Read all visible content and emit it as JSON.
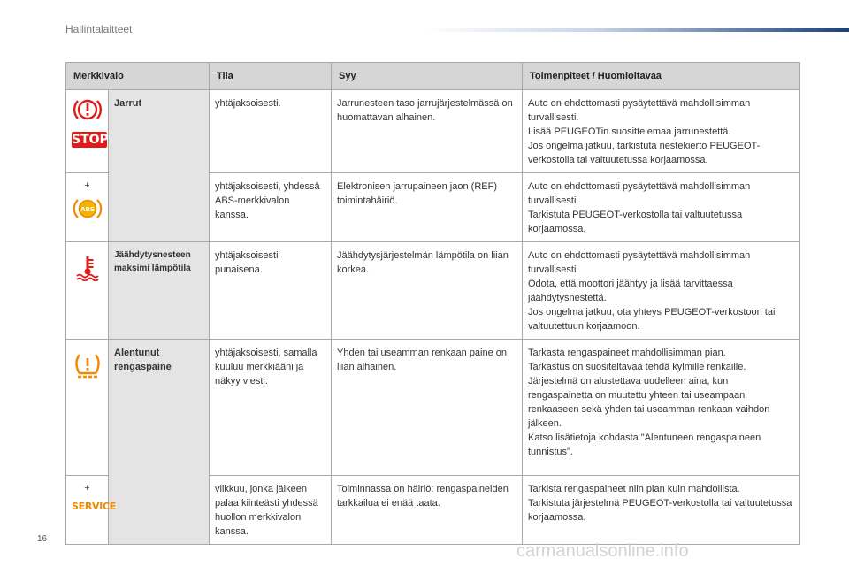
{
  "page": {
    "section_title": "Hallintalaitteet",
    "page_number": "16",
    "watermark": "carmanualsonline.info"
  },
  "table": {
    "headers": {
      "symbol": "Merkkivalo",
      "state": "Tila",
      "cause": "Syy",
      "action": "Toimenpiteet / Huomioitavaa"
    },
    "rows": [
      {
        "icon": "brake-warning-icon",
        "icon_label": "STOP",
        "name": "Jarrut",
        "state": "yhtäjaksoisesti.",
        "cause": "Jarrunesteen taso jarrujärjestelmässä on huomattavan alhainen.",
        "action": "Auto on ehdottomasti pysäytettävä mahdollisimman turvallisesti.\nLisää PEUGEOTin suosittelemaa jarrunestettä.\nJos ongelma jatkuu, tarkistuta nestekierto PEUGEOT-verkostolla tai valtuutetussa korjaamossa."
      },
      {
        "plus": "+",
        "icon": "abs-icon",
        "state": "yhtäjaksoisesti, yhdessä ABS-merkkivalon kanssa.",
        "cause": "Elektronisen jarrupaineen jaon (REF) toimintahäiriö.",
        "action": "Auto on ehdottomasti pysäytettävä mahdollisimman turvallisesti.\nTarkistuta PEUGEOT-verkostolla tai valtuutetussa korjaamossa."
      },
      {
        "icon": "coolant-temperature-icon",
        "name": "Jäähdytysnesteen maksimi lämpötila",
        "state": "yhtäjaksoisesti punaisena.",
        "cause": "Jäähdytysjärjestelmän lämpötila on liian korkea.",
        "action": "Auto on ehdottomasti pysäytettävä mahdollisimman turvallisesti.\nOdota, että moottori jäähtyy ja lisää tarvittaessa jäähdytysnestettä.\nJos ongelma jatkuu, ota yhteys PEUGEOT-verkostoon tai valtuutettuun korjaamoon."
      },
      {
        "icon": "tyre-pressure-icon",
        "name": "Alentunut rengaspaine",
        "state": "yhtäjaksoisesti, samalla kuuluu merkkiääni ja näkyy viesti.",
        "cause": "Yhden tai useamman renkaan paine on liian alhainen.",
        "action": "Tarkasta rengaspaineet mahdollisimman pian.\nTarkastus on suositeltavaa tehdä kylmille renkaille.\nJärjestelmä on alustettava uudelleen aina, kun rengaspainetta on muutettu yhteen tai useampaan renkaaseen sekä yhden tai useamman renkaan vaihdon jälkeen.\nKatso lisätietoja kohdasta \"Alentuneen rengaspaineen tunnistus\"."
      },
      {
        "plus": "+",
        "icon": "service-icon",
        "icon_label": "SERVICE",
        "state": "vilkkuu, jonka jälkeen palaa kiinteästi yhdessä huollon merkkivalon kanssa.",
        "cause": "Toiminnassa on häiriö: rengaspaineiden tarkkailua ei enää taata.",
        "action": "Tarkista rengaspaineet niin pian kuin mahdollista.\nTarkistuta järjestelmä PEUGEOT-verkostolla tai valtuutetussa korjaamossa."
      }
    ]
  },
  "colors": {
    "red": "#e01b1b",
    "orange": "#f08a00",
    "header_gray": "#d6d6d6",
    "name_gray": "#e4e4e4"
  }
}
